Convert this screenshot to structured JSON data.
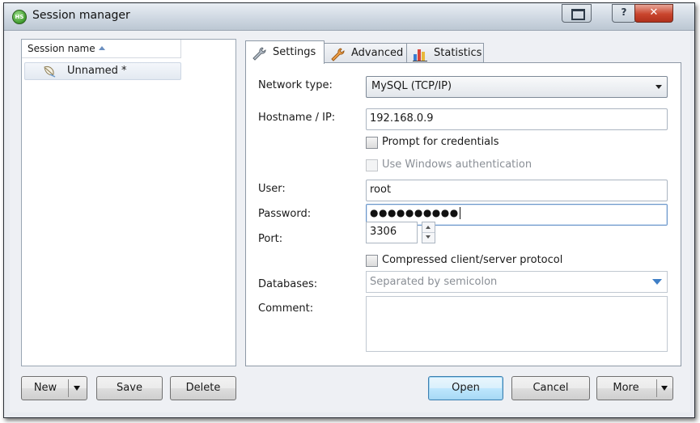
{
  "window": {
    "title": "Session manager",
    "app_icon_text": "HS"
  },
  "sessions": {
    "header": "Session name",
    "items": [
      {
        "label": "Unnamed *"
      }
    ]
  },
  "tabs": [
    {
      "label": "Settings",
      "active": true
    },
    {
      "label": "Advanced",
      "active": false
    },
    {
      "label": "Statistics",
      "active": false
    }
  ],
  "settings": {
    "network_type_label": "Network type:",
    "network_type_value": "MySQL (TCP/IP)",
    "hostname_label": "Hostname / IP:",
    "hostname_value": "192.168.0.9",
    "prompt_credentials_label": "Prompt for credentials",
    "prompt_credentials_checked": false,
    "windows_auth_label": "Use Windows authentication",
    "windows_auth_checked": false,
    "user_label": "User:",
    "user_value": "root",
    "password_label": "Password:",
    "password_masked": "●●●●●●●●●●",
    "port_label": "Port:",
    "port_value": "3306",
    "compressed_label": "Compressed client/server protocol",
    "compressed_checked": false,
    "databases_label": "Databases:",
    "databases_placeholder": "Separated by semicolon",
    "comment_label": "Comment:",
    "comment_value": ""
  },
  "buttons": {
    "new": "New",
    "save": "Save",
    "delete": "Delete",
    "open": "Open",
    "cancel": "Cancel",
    "more": "More"
  },
  "colors": {
    "accent": "#3c7fb1",
    "close_button": "#c9452d",
    "combo_arrow": "#3f7fc6"
  }
}
